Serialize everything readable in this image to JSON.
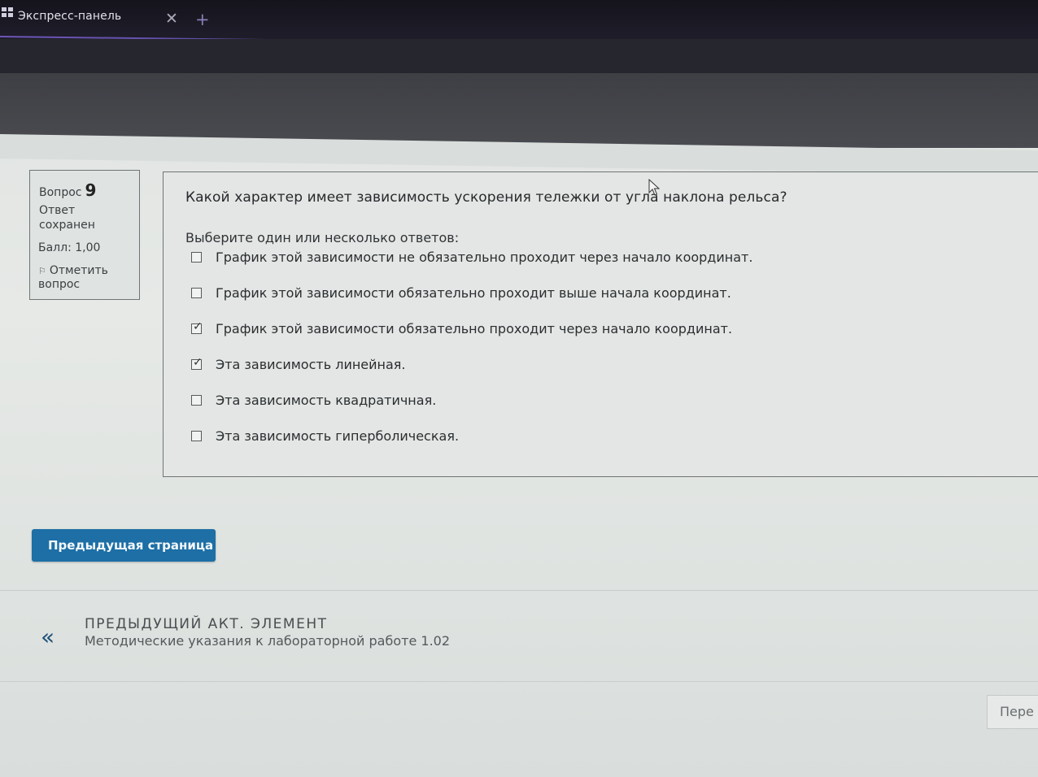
{
  "browser": {
    "tab_title": "Экспресс-панель",
    "close_symbol": "✕",
    "new_tab_symbol": "+"
  },
  "question_info": {
    "label": "Вопрос",
    "number": "9",
    "status": "Ответ сохранен",
    "score": "Балл: 1,00",
    "flag_label": "Отметить вопрос"
  },
  "question": {
    "text": "Какой характер имеет зависимость ускорения тележки от угла наклона рельса?",
    "prompt": "Выберите один или несколько ответов:",
    "options": [
      {
        "label": "График этой зависимости  не обязательно проходит через начало координат.",
        "checked": false
      },
      {
        "label": "График этой зависимости  обязательно проходит выше  начала координат.",
        "checked": false
      },
      {
        "label": "График этой зависимости обязательно проходит через начало координат.",
        "checked": true
      },
      {
        "label": "Эта зависимость  линейная.",
        "checked": true
      },
      {
        "label": "Эта зависимость  квадратичная.",
        "checked": false
      },
      {
        "label": "Эта зависимость  гиперболическая.",
        "checked": false
      }
    ]
  },
  "navigation": {
    "prev_page_label": "Предыдущая страница",
    "prev_activity_heading": "ПРЕДЫДУЩИЙ АКТ. ЭЛЕМЕНТ",
    "prev_activity_title": "Методические указания к лабораторной работе 1.02",
    "chevron_symbol": "«",
    "next_label": "Пере"
  },
  "colors": {
    "primary_button": "#1d6fa6",
    "tab_accent": "#6d56b8"
  }
}
